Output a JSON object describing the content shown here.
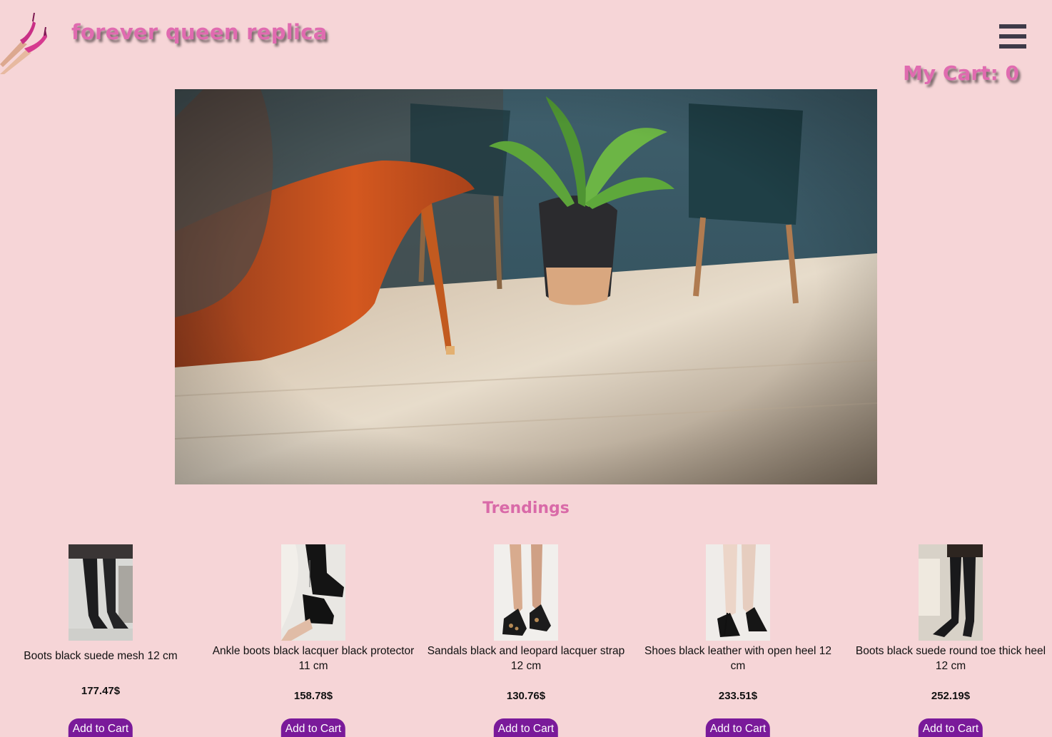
{
  "header": {
    "brand": "forever queen replica",
    "cart_label": "My Cart: 0",
    "logo_icon": "high-heels-legs-icon",
    "menu_icon": "hamburger-menu-icon"
  },
  "hero": {
    "image": "orange-stiletto-heel-photo"
  },
  "trending": {
    "title": "Trendings",
    "products": [
      {
        "name": "Boots black suede mesh 12 cm",
        "price": "177.47$",
        "button": "Add to Cart",
        "image": "mesh-boots-photo"
      },
      {
        "name": "Ankle boots black lacquer black protector 11 cm",
        "price": "158.78$",
        "button": "Add to Cart",
        "image": "lacquer-ankle-boots-photo"
      },
      {
        "name": "Sandals black and leopard lacquer strap 12 cm",
        "price": "130.76$",
        "button": "Add to Cart",
        "image": "leopard-sandals-photo"
      },
      {
        "name": "Shoes black leather with open heel 12 cm",
        "price": "233.51$",
        "button": "Add to Cart",
        "image": "open-heel-shoes-photo"
      },
      {
        "name": "Boots black suede round toe thick heel 12 cm",
        "price": "252.19$",
        "button": "Add to Cart",
        "image": "thigh-boots-photo"
      }
    ]
  },
  "colors": {
    "background": "#f6d5d7",
    "brand_pink": "#e06bb0",
    "button_purple": "#7a1a9a"
  }
}
